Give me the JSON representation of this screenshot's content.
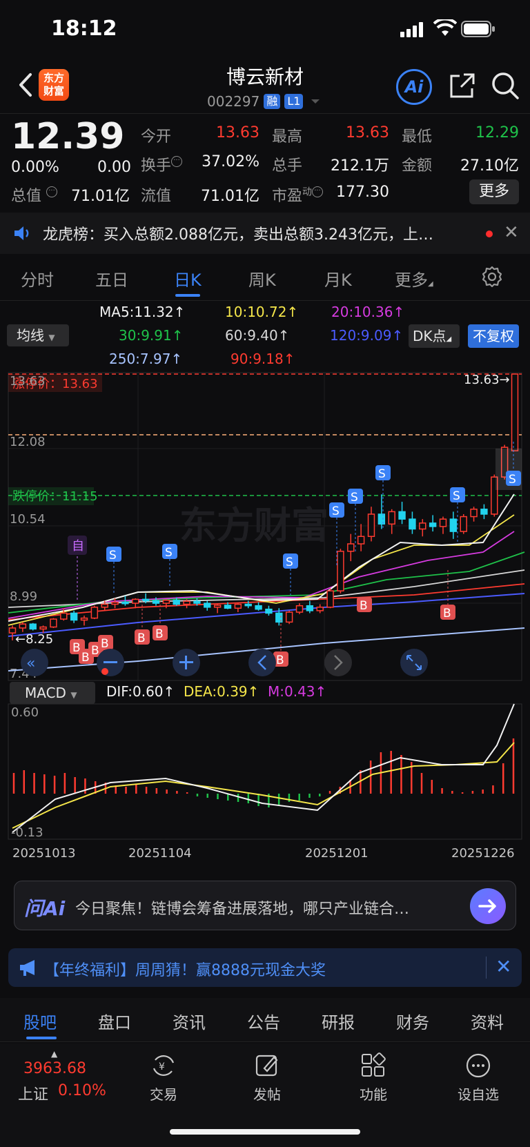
{
  "status_bar": {
    "time": "18:12"
  },
  "header": {
    "logo_text_1": "东方",
    "logo_text_2": "财富",
    "stock_name": "博云新材",
    "stock_code": "002297",
    "tag_margin": "融",
    "tag_level": "L1",
    "ai_label": "Ai"
  },
  "quote": {
    "price": "12.39",
    "change_pct": "0.00%",
    "change_abs": "0.00",
    "mktcap_label": "总值",
    "mktcap": "71.01亿",
    "open_label": "今开",
    "open": "13.63",
    "high_label": "最高",
    "high": "13.63",
    "low_label": "最低",
    "low": "12.29",
    "turnover_label": "换手",
    "turnover": "37.02%",
    "volume_label": "总手",
    "volume": "212.1万",
    "amount_label": "金额",
    "amount": "27.10亿",
    "float_label": "流值",
    "float_cap": "71.01亿",
    "pe_label": "市盈",
    "pe_sup": "动",
    "pe": "177.30",
    "more_label": "更多"
  },
  "ticker": {
    "text": "龙虎榜：买入总额2.088亿元，卖出总额3.243亿元，上…"
  },
  "kline_tabs": [
    "分时",
    "五日",
    "日K",
    "周K",
    "月K",
    "更多"
  ],
  "ma": {
    "selector": "均线",
    "ma5": "MA5:11.32↑",
    "ma10": "10:10.72↑",
    "ma20": "20:10.36↑",
    "ma30": "30:9.91↑",
    "ma60": "60:9.40↑",
    "ma120": "120:9.09↑",
    "ma250": "250:7.97↑",
    "ma90": "90:9.18↑",
    "dk_label": "DK点",
    "fq_label": "不复权"
  },
  "colors": {
    "up": "#ff3b30",
    "down": "#1fc24a",
    "accent": "#3b82f6",
    "ma5": "#f2f2f2",
    "ma10": "#f5e64a",
    "ma20": "#d63be0",
    "ma30": "#1fc24a",
    "ma60": "#d8d8d8",
    "ma120": "#4b5bff",
    "ma250": "#a8c4ff",
    "ma90": "#ff3b30"
  },
  "chart_data": {
    "type": "candlestick",
    "y_labels": [
      "13.63",
      "12.08",
      "10.54",
      "8.99",
      "7.44"
    ],
    "limit_up_label": "涨停价：13.63",
    "limit_down_label": "跌停价：11.15",
    "last_high_label": "13.63→",
    "low_marker_label": "←8.25",
    "buy_marker": "B",
    "sell_marker": "S",
    "self_marker": "自",
    "x_labels": [
      "20251013",
      "20251104",
      "20251201",
      "20251226"
    ],
    "ylim": [
      7.44,
      13.63
    ],
    "candles": [
      [
        8.4,
        8.55,
        8.25,
        8.5
      ],
      [
        8.5,
        8.62,
        8.42,
        8.58
      ],
      [
        8.58,
        8.6,
        8.45,
        8.48
      ],
      [
        8.48,
        8.55,
        8.4,
        8.52
      ],
      [
        8.52,
        8.7,
        8.5,
        8.68
      ],
      [
        8.68,
        8.9,
        8.65,
        8.8
      ],
      [
        8.8,
        8.85,
        8.6,
        8.66
      ],
      [
        8.66,
        8.75,
        8.55,
        8.7
      ],
      [
        8.7,
        8.95,
        8.68,
        8.92
      ],
      [
        8.92,
        9.05,
        8.85,
        8.98
      ],
      [
        8.98,
        9.1,
        8.9,
        9.02
      ],
      [
        9.02,
        9.15,
        8.95,
        9.0
      ],
      [
        9.0,
        9.1,
        8.9,
        9.08
      ],
      [
        9.08,
        9.2,
        9.0,
        9.05
      ],
      [
        9.05,
        9.12,
        8.95,
        9.0
      ],
      [
        9.0,
        9.08,
        8.9,
        9.06
      ],
      [
        9.06,
        9.12,
        8.95,
        8.98
      ],
      [
        8.98,
        9.08,
        8.9,
        9.04
      ],
      [
        9.04,
        9.1,
        8.95,
        9.0
      ],
      [
        9.0,
        9.05,
        8.85,
        8.92
      ],
      [
        8.92,
        9.0,
        8.8,
        8.96
      ],
      [
        8.96,
        9.02,
        8.88,
        8.9
      ],
      [
        8.9,
        9.0,
        8.82,
        8.98
      ],
      [
        8.98,
        9.05,
        8.9,
        8.95
      ],
      [
        8.95,
        9.02,
        8.85,
        8.88
      ],
      [
        8.88,
        8.95,
        8.75,
        8.8
      ],
      [
        8.8,
        8.9,
        8.55,
        8.62
      ],
      [
        8.62,
        8.85,
        8.58,
        8.82
      ],
      [
        8.82,
        9.0,
        8.78,
        8.95
      ],
      [
        8.95,
        9.05,
        8.8,
        8.85
      ],
      [
        8.85,
        8.98,
        8.8,
        8.92
      ],
      [
        8.92,
        9.3,
        8.9,
        9.25
      ],
      [
        9.25,
        10.1,
        9.2,
        10.05
      ],
      [
        10.05,
        10.4,
        9.85,
        10.2
      ],
      [
        10.2,
        10.6,
        10.05,
        10.35
      ],
      [
        10.35,
        10.95,
        10.25,
        10.8
      ],
      [
        10.8,
        11.2,
        10.5,
        10.6
      ],
      [
        10.6,
        10.9,
        10.4,
        10.85
      ],
      [
        10.85,
        11.05,
        10.6,
        10.7
      ],
      [
        10.7,
        10.85,
        10.4,
        10.5
      ],
      [
        10.5,
        10.7,
        10.35,
        10.62
      ],
      [
        10.62,
        10.78,
        10.45,
        10.55
      ],
      [
        10.55,
        10.75,
        10.4,
        10.7
      ],
      [
        10.7,
        10.85,
        10.3,
        10.45
      ],
      [
        10.45,
        10.8,
        10.4,
        10.75
      ],
      [
        10.75,
        10.95,
        10.65,
        10.9
      ],
      [
        10.9,
        11.0,
        10.7,
        10.8
      ],
      [
        10.8,
        11.6,
        10.75,
        11.55
      ],
      [
        11.55,
        12.2,
        11.5,
        12.15
      ],
      [
        12.08,
        13.63,
        12.08,
        13.63
      ]
    ]
  },
  "macd": {
    "selector": "MACD",
    "dif": "DIF:0.60↑",
    "dea": "DEA:0.39↑",
    "m": "M:0.43↑",
    "y_top": "0.60",
    "y_bottom": "-0.13"
  },
  "ai_bar": {
    "logo": "问Ai",
    "text": "今日聚焦！链博会筹备进展落地，哪只产业链合…"
  },
  "promo": {
    "text": "【年终福利】周周猜！赢8888元现金大奖"
  },
  "bottom_tabs": [
    "股吧",
    "盘口",
    "资讯",
    "公告",
    "研报",
    "财务",
    "资料"
  ],
  "dock": {
    "index_value": "3963.68",
    "index_name": "上证",
    "index_pct": "0.10%",
    "trade": "交易",
    "post": "发帖",
    "functions": "功能",
    "watchlist": "设自选"
  }
}
